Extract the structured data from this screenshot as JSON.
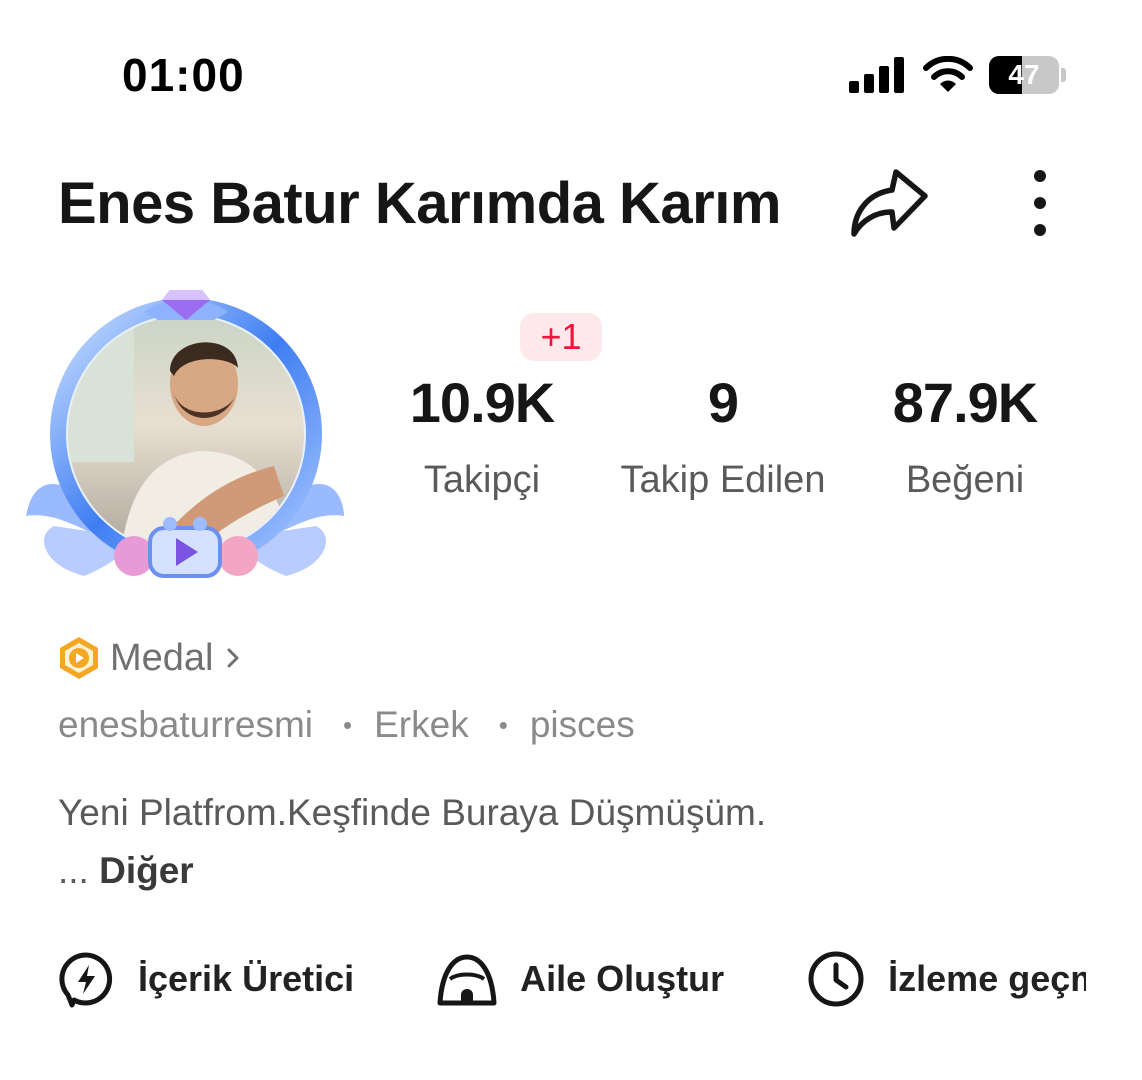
{
  "status_bar": {
    "time": "01:00",
    "battery": "47",
    "battery_level": 0.47
  },
  "header": {
    "title": "Enes Batur Karımda Karım",
    "share_icon": "share-arrow-icon",
    "more_icon": "more-vertical-icon"
  },
  "stats": {
    "followers_delta": "+1",
    "items": [
      {
        "value": "10.9K",
        "label": "Takipçi"
      },
      {
        "value": "9",
        "label": "Takip Edilen"
      },
      {
        "value": "87.9K",
        "label": "Beğeni"
      }
    ]
  },
  "profile": {
    "medal_label": "Medal",
    "username": "enesbaturresmi",
    "gender": "Erkek",
    "zodiac": "pisces",
    "bio": "Yeni Platfrom.Keşfinde Buraya Düşmüşüm.",
    "bio_ellipsis": "...",
    "bio_more": "Diğer"
  },
  "actions": [
    {
      "label": "İçerik Üretici",
      "icon": "lightning-icon"
    },
    {
      "label": "Aile Oluştur",
      "icon": "tent-icon"
    },
    {
      "label": "İzleme geçmişi",
      "icon": "clock-icon"
    }
  ],
  "colors": {
    "accent_red": "#f3123a",
    "badge_bg": "#fde9eb",
    "medal_orange": "#f5a623"
  }
}
